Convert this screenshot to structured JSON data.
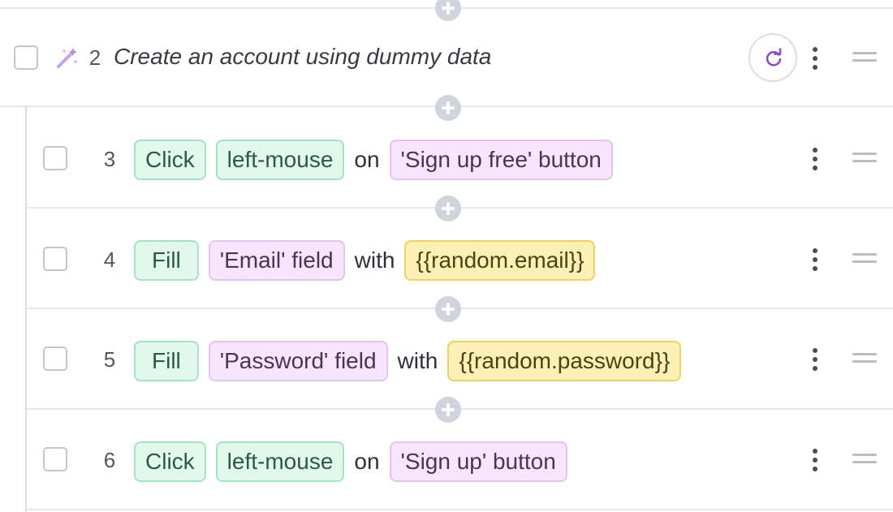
{
  "group": {
    "number": "2",
    "title": "Create an account using dummy data",
    "icon": "magic-wand-icon",
    "action_icon": "refresh-icon"
  },
  "steps": [
    {
      "number": "3",
      "action": "Click",
      "param": "left-mouse",
      "connector": "on",
      "target": "'Sign up free' button",
      "value": ""
    },
    {
      "number": "4",
      "action": "Fill",
      "param": "",
      "connector": "with",
      "target": "'Email' field",
      "value": "{{random.email}}"
    },
    {
      "number": "5",
      "action": "Fill",
      "param": "",
      "connector": "with",
      "target": "'Password' field",
      "value": "{{random.password}}"
    },
    {
      "number": "6",
      "action": "Click",
      "param": "left-mouse",
      "connector": "on",
      "target": "'Sign up' button",
      "value": ""
    }
  ],
  "colors": {
    "action_chip": "#e3f8ec",
    "target_chip": "#f7e6fb",
    "value_chip": "#fdf0b4",
    "accent": "#8a4fc2"
  }
}
